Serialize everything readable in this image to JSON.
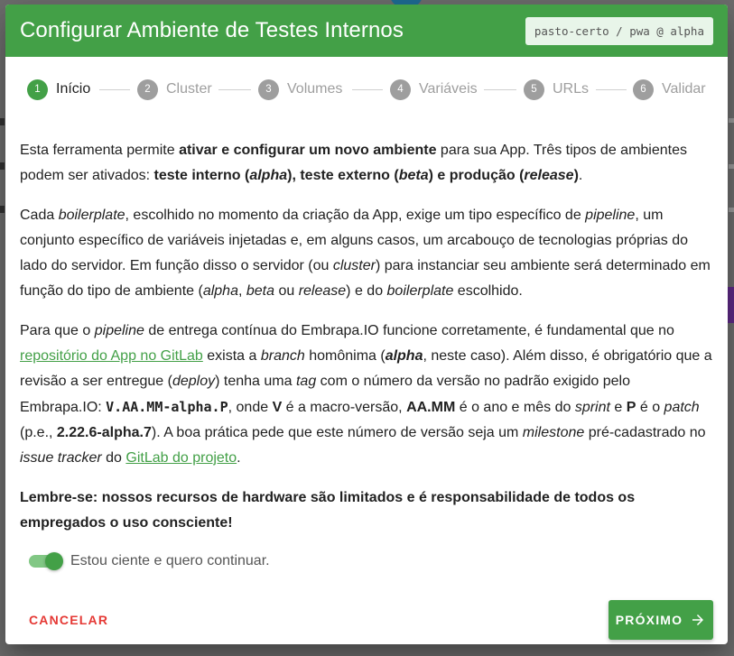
{
  "dialog": {
    "title": "Configurar Ambiente de Testes Internos",
    "badge": "pasto-certo / pwa @ alpha"
  },
  "stepper": {
    "steps": [
      {
        "number": "1",
        "label": "Início",
        "active": true
      },
      {
        "number": "2",
        "label": "Cluster",
        "active": false
      },
      {
        "number": "3",
        "label": "Volumes",
        "active": false
      },
      {
        "number": "4",
        "label": "Variáveis",
        "active": false
      },
      {
        "number": "5",
        "label": "URLs",
        "active": false
      },
      {
        "number": "6",
        "label": "Validar",
        "active": false
      }
    ]
  },
  "content": {
    "p1": {
      "t1": "Esta ferramenta permite ",
      "b1": "ativar e configurar um novo ambiente",
      "t2": " para sua App. Três tipos de ambientes podem ser ativados: ",
      "b2": "teste interno (",
      "bi1": "alpha",
      "b3": "), teste externo (",
      "bi2": "beta",
      "b4": ") e produção (",
      "bi3": "release",
      "b5": ")",
      "t3": "."
    },
    "p2": {
      "t1": "Cada ",
      "i1": "boilerplate",
      "t2": ", escolhido no momento da criação da App, exige um tipo específico de ",
      "i2": "pipeline",
      "t3": ", um conjunto específico de variáveis injetadas e, em alguns casos, um arcabouço de tecnologias próprias do lado do servidor. Em função disso o servidor (ou ",
      "i3": "cluster",
      "t4": ") para instanciar seu ambiente será determinado em função do tipo de ambiente (",
      "i4": "alpha",
      "t5": ", ",
      "i5": "beta",
      "t6": " ou ",
      "i6": "release",
      "t7": ") e do ",
      "i7": "boilerplate",
      "t8": " escolhido."
    },
    "p3": {
      "t1": "Para que o ",
      "i1": "pipeline",
      "t2": " de entrega contínua do Embrapa.IO funcione corretamente, é fundamental que no ",
      "link1": "repositório do App no GitLab",
      "t3": " exista a ",
      "i2": "branch",
      "t4": " homônima (",
      "bi1": "alpha",
      "t5": ", neste caso). Além disso, é obrigatório que a revisão a ser entregue (",
      "i3": "deploy",
      "t6": ") tenha uma ",
      "i4": "tag",
      "t7": " com o número da versão no padrão exigido pelo Embrapa.IO: ",
      "code1": "V.AA.MM-alpha.P",
      "t8": ", onde ",
      "b1": "V",
      "t9": " é a macro-versão, ",
      "b2": "AA.MM",
      "t10": " é o ano e mês do ",
      "i5": "sprint",
      "t11": " e ",
      "b3": "P",
      "t12": " é o ",
      "i6": "patch",
      "t13": " (p.e., ",
      "b4": "2.22.6-alpha.7",
      "t14": "). A boa prática pede que este número de versão seja um ",
      "i7": "milestone",
      "t15": " pré-cadastrado no ",
      "i8": "issue tracker",
      "t16": " do ",
      "link2": "GitLab do projeto",
      "t17": "."
    },
    "warning": "Lembre-se: nossos recursos de hardware são limitados e é responsabilidade de todos os empregados o uso consciente!"
  },
  "consent": {
    "label": "Estou ciente e quero continuar.",
    "checked": true
  },
  "actions": {
    "cancel_label": "CANCELAR",
    "next_label": "PRÓXIMO"
  },
  "colors": {
    "primary": "#43a047",
    "danger": "#e53935",
    "inactive_step": "#9e9e9e"
  }
}
